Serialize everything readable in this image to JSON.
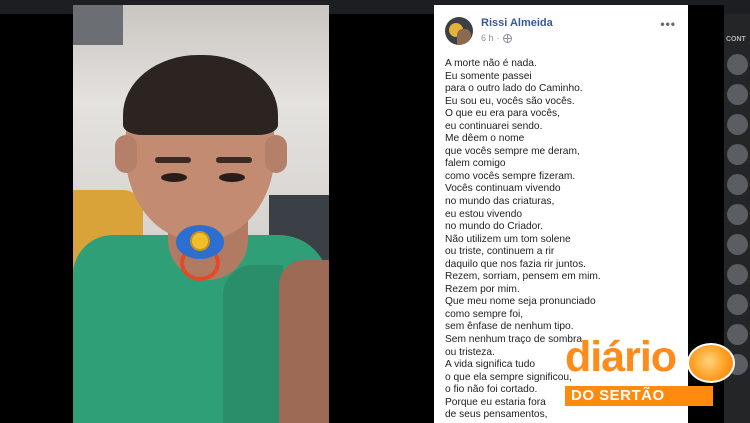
{
  "post": {
    "author": "Rissi Almeida",
    "time": "6 h",
    "dot_separator": "·",
    "more_icon": "•••",
    "poem_lines": [
      "A morte não é nada.",
      "Eu somente passei",
      "para o outro lado do Caminho.",
      "Eu sou eu, vocês são vocês.",
      "O que eu era para vocês,",
      "eu continuarei sendo.",
      "Me dêem o nome",
      "que vocês sempre me deram,",
      "falem comigo",
      "como vocês sempre fizeram.",
      "Vocês continuam vivendo",
      "no mundo das criaturas,",
      "eu estou vivendo",
      "no mundo do Criador.",
      "Não utilizem um tom solene",
      "ou triste, continuem a rir",
      "daquilo que nos fazia rir juntos.",
      "Rezem, sorriam, pensem em mim.",
      "Rezem por mim.",
      "Que meu nome seja pronunciado",
      "como sempre foi,",
      "sem ênfase de nenhum tipo.",
      "Sem nenhum traço de sombra",
      "ou tristeza.",
      "A vida significa tudo",
      "o que ela sempre significou,",
      "o fio não foi cortado.",
      "Porque eu estaria fora",
      "de seus pensamentos,"
    ]
  },
  "sidebar": {
    "label": "CONT"
  },
  "watermark": {
    "brand_word": "diário",
    "brand_sub": "DO SERTÃO"
  },
  "colors": {
    "author_link": "#385898",
    "brand_orange": "#ff8c1a"
  }
}
